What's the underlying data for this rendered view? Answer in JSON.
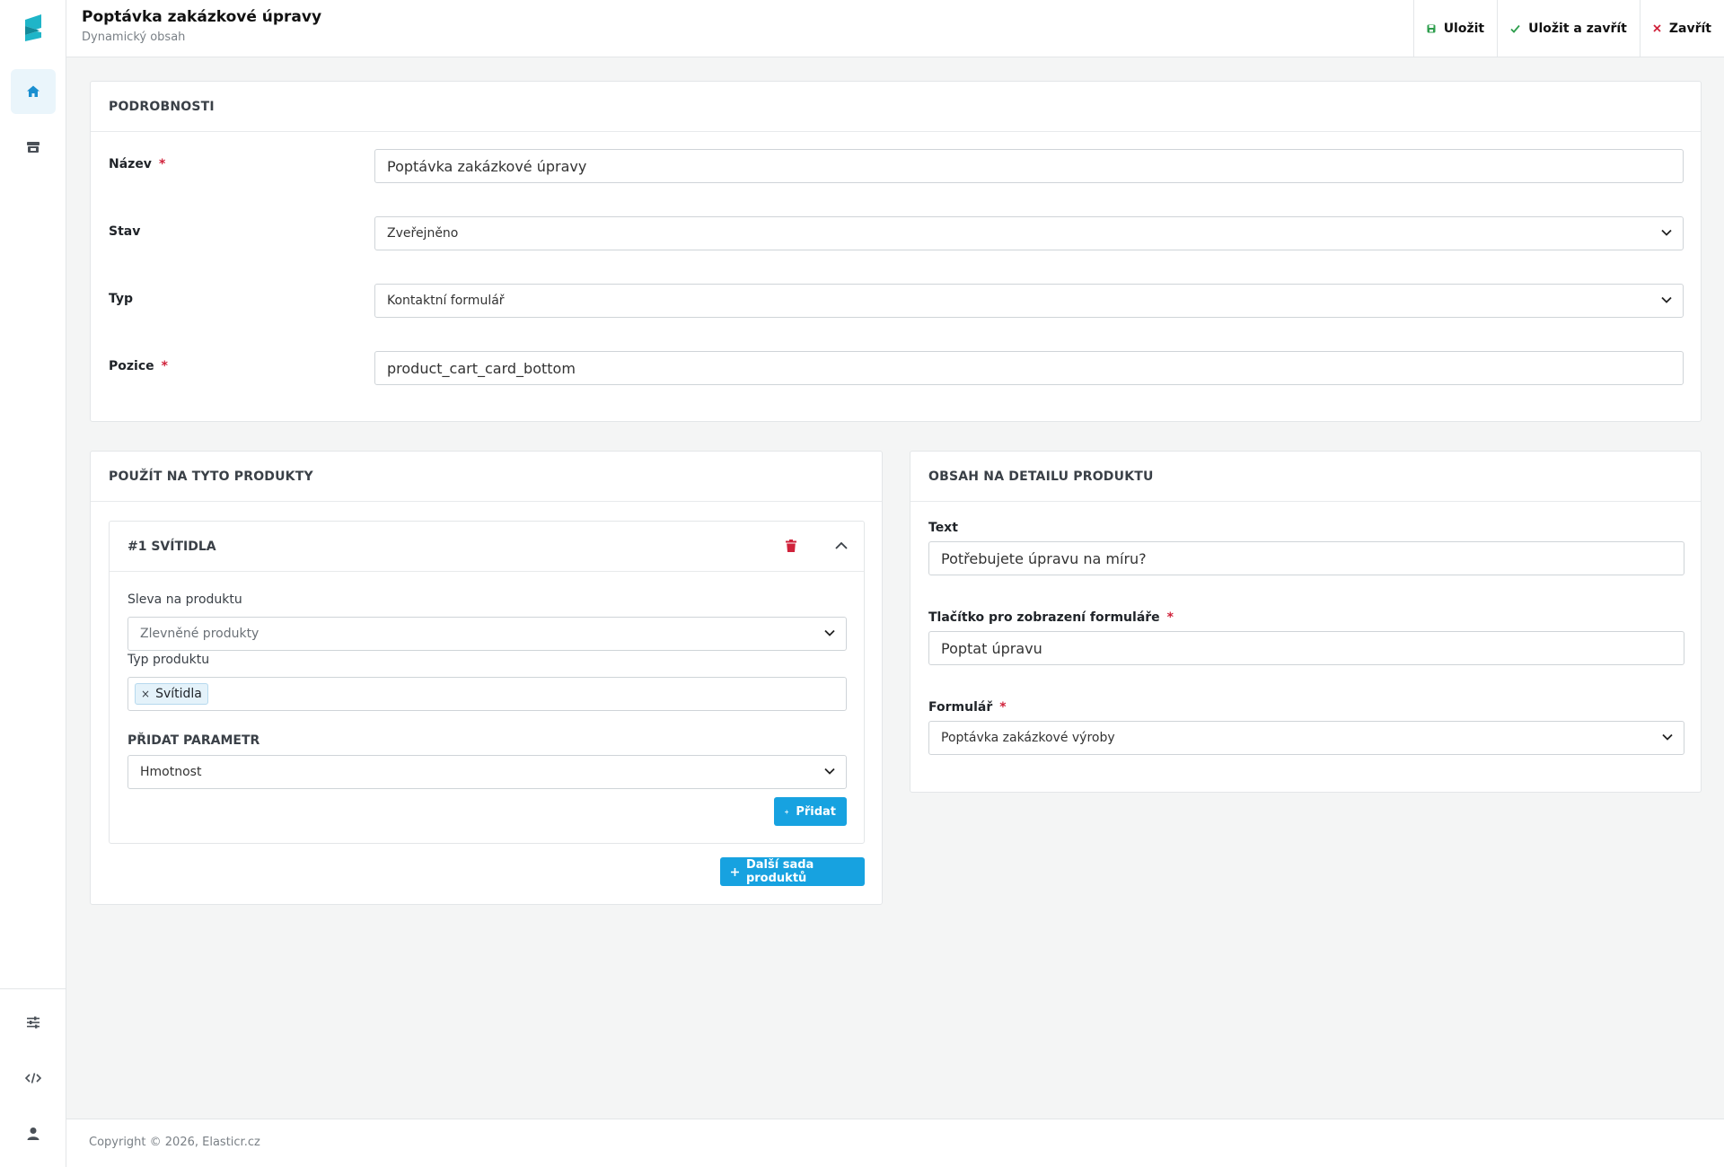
{
  "colors": {
    "accent": "#17a2e0",
    "brand": "#1fb5c8",
    "required": "#d0223b",
    "save_icon": "#2e9e4d"
  },
  "header": {
    "title": "Poptávka zakázkové úpravy",
    "subtitle": "Dynamický obsah",
    "actions": [
      {
        "label": "Uložit",
        "icon": "save-icon"
      },
      {
        "label": "Uložit a zavřít",
        "icon": "check-icon"
      },
      {
        "label": "Zavřít",
        "icon": "close-icon"
      }
    ]
  },
  "sidebar": {
    "items": [
      {
        "icon": "home-icon",
        "active": true
      },
      {
        "icon": "store-icon",
        "active": false
      },
      {
        "icon": "sliders-icon",
        "active": false
      },
      {
        "icon": "code-icon",
        "active": false
      },
      {
        "icon": "user-icon",
        "active": false
      }
    ]
  },
  "details": {
    "heading": "PODROBNOSTI",
    "name_label": "Název",
    "name_value": "Poptávka zakázkové úpravy",
    "state_label": "Stav",
    "state_value": "Zveřejněno",
    "type_label": "Typ",
    "type_value": "Kontaktní formulář",
    "position_label": "Pozice",
    "position_value": "product_cart_card_bottom",
    "required_mark": "*"
  },
  "products": {
    "heading": "POUŽÍT NA TYTO PRODUKTY",
    "set": {
      "title": "#1 SVÍTIDLA",
      "discount_label": "Sleva na produktu",
      "discount_value": "Zlevněné produkty",
      "product_type_label": "Typ produktu",
      "product_type_tags": [
        "Svítidla"
      ],
      "tag_remove": "×",
      "add_param_label": "PŘIDAT PARAMETR",
      "param_value": "Hmotnost",
      "add_button": "Přidat"
    },
    "next_set_button": "Další sada produktů"
  },
  "detail_content": {
    "heading": "OBSAH NA DETAILU PRODUKTU",
    "text_label": "Text",
    "text_value": "Potřebujete úpravu na míru?",
    "button_label": "Tlačítko pro zobrazení formuláře",
    "button_value": "Poptat úpravu",
    "form_label": "Formulář",
    "form_value": "Poptávka zakázkové výroby"
  },
  "footer": {
    "copyright": "Copyright © 2026, Elasticr.cz"
  }
}
